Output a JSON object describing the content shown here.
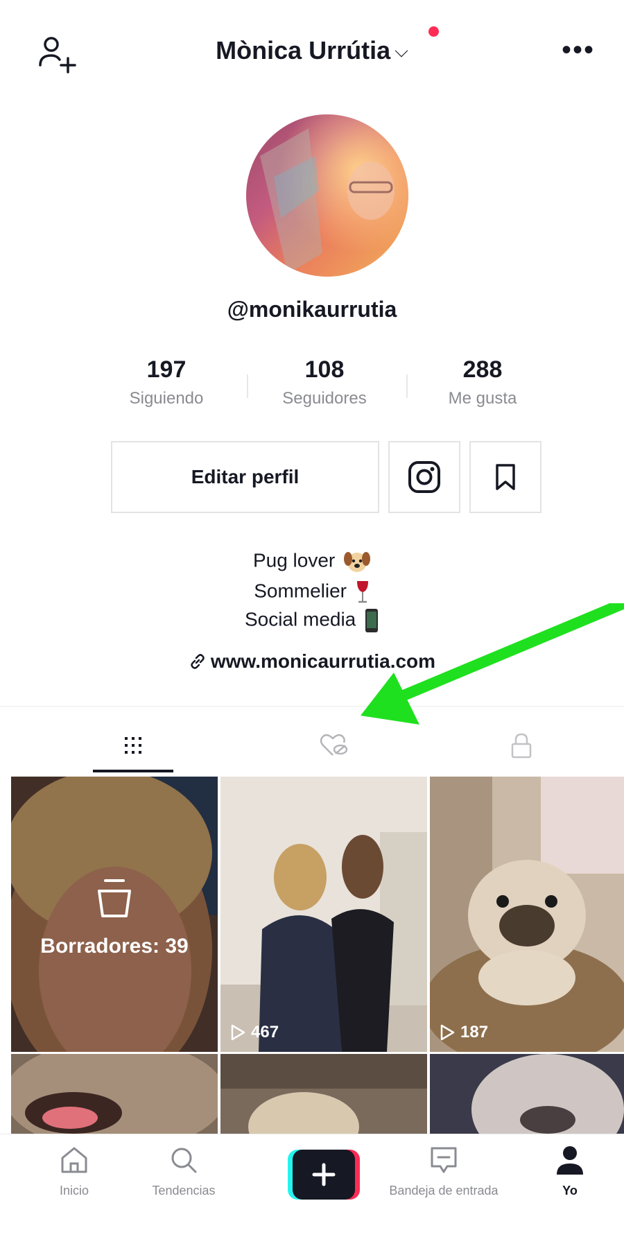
{
  "header": {
    "title": "Mònica Urrútia",
    "title_chevron": "⌵",
    "more": "•••",
    "notification_color": "#fe2c55"
  },
  "profile": {
    "username": "@monikaurrutia",
    "stats": [
      {
        "value": "197",
        "label": "Siguiendo"
      },
      {
        "value": "108",
        "label": "Seguidores"
      },
      {
        "value": "288",
        "label": "Me gusta"
      }
    ],
    "edit_button": "Editar perfil",
    "bio": [
      "Pug lover",
      "Sommelier",
      "Social media"
    ],
    "link": "www.monicaurrutia.com"
  },
  "tabs": [
    {
      "name": "videos",
      "icon": "grid-icon",
      "active": true
    },
    {
      "name": "liked",
      "icon": "hidden-heart-icon",
      "active": false
    },
    {
      "name": "private",
      "icon": "lock-icon",
      "active": false
    }
  ],
  "grid": {
    "drafts_label": "Borradores: 39",
    "items": [
      {
        "views": "467"
      },
      {
        "views": "187"
      }
    ]
  },
  "bottom_nav": [
    {
      "label": "Inicio",
      "icon": "home-icon"
    },
    {
      "label": "Tendencias",
      "icon": "search-icon"
    },
    {
      "label": "",
      "icon": "create-icon"
    },
    {
      "label": "Bandeja de entrada",
      "icon": "inbox-icon"
    },
    {
      "label": "Yo",
      "icon": "profile-icon",
      "active": true
    }
  ],
  "colors": {
    "accent_red": "#fe2c55",
    "accent_cyan": "#25f4ee",
    "arrow_green": "#1fe01f"
  }
}
